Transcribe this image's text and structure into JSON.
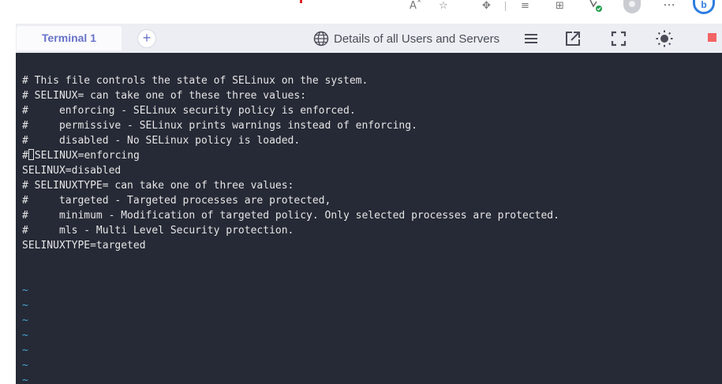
{
  "browser": {
    "font_size_label": "Aˆ",
    "favorite_glyph": "☆",
    "extensions_glyph": "✥",
    "collections_glyph": "≡",
    "add_glyph": "⊞",
    "more_label": "…",
    "copilot_label": "b"
  },
  "header": {
    "tab_label": "Terminal 1",
    "add_tab_label": "+",
    "details_label": "Details of all Users and Servers"
  },
  "terminal": {
    "lines": [
      "# This file controls the state of SELinux on the system.",
      "# SELINUX= can take one of these three values:",
      "#     enforcing - SELinux security policy is enforced.",
      "#     permissive - SELinux prints warnings instead of enforcing.",
      "#     disabled - No SELinux policy is loaded.",
      "#",
      "SELINUX=disabled",
      "# SELINUXTYPE= can take one of three values:",
      "#     targeted - Targeted processes are protected,",
      "#     minimum - Modification of targeted policy. Only selected processes are protected.",
      "#     mls - Multi Level Security protection.",
      "SELINUXTYPE=targeted"
    ],
    "cursor_line_rest": "SELINUX=enforcing",
    "tildes": [
      "~",
      "~",
      "~",
      "~",
      "~",
      "~",
      "~"
    ]
  },
  "colors": {
    "terminal_bg": "#262a36",
    "terminal_fg": "#e6e6e6",
    "tilde": "#45a8d8",
    "tab_accent": "#6873c9",
    "stop": "#f36464"
  }
}
